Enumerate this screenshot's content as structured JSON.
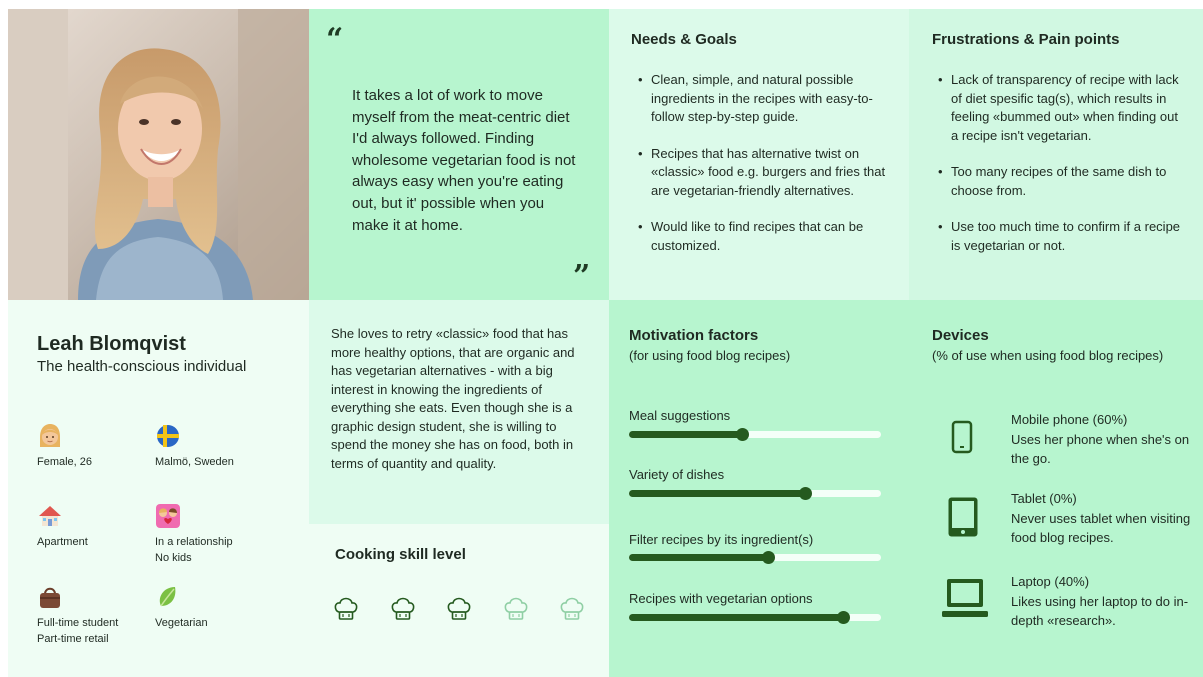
{
  "persona": {
    "name": "Leah Blomqvist",
    "tagline": "The health-conscious individual",
    "attributes": [
      {
        "icon": "woman-face-icon",
        "label": "Female, 26"
      },
      {
        "icon": "swedish-flag-icon",
        "label": "Malmö, Sweden"
      },
      {
        "icon": "house-icon",
        "label": "Apartment"
      },
      {
        "icon": "couple-icon",
        "label": "In a relationship\nNo kids"
      },
      {
        "icon": "handbag-icon",
        "label": "Full-time student\nPart-time retail"
      },
      {
        "icon": "leafy-green-icon",
        "label": "Vegetarian"
      }
    ]
  },
  "quote": {
    "open_mark": "“",
    "close_mark": "”",
    "text": "It takes a lot of work to move myself from the meat-centric diet I'd always followed. Finding wholesome vegetarian food is not always easy when you're eating out, but it' possible when you make it at home."
  },
  "needs_goals": {
    "title": "Needs & Goals",
    "items": [
      "Clean, simple, and natural possible ingredients in the recipes with easy-to-follow step-by-step guide.",
      "Recipes that has alternative twist on «classic» food e.g. burgers and fries that are vegetarian-friendly alternatives.",
      "Would like to find recipes that can be customized."
    ]
  },
  "frustrations": {
    "title": "Frustrations & Pain points",
    "items": [
      "Lack of transparency of recipe with lack of diet spesific tag(s), which results in feeling «bummed out» when finding out a recipe isn't vegetarian.",
      "Too many recipes of the same dish to choose from.",
      "Use too much time to confirm if a recipe is vegetarian or not."
    ]
  },
  "bio": {
    "text": "She loves to retry «classic» food that has more healthy options, that are organic and has vegetarian alternatives - with a big interest in knowing the ingredients of everything she eats. Even though she is a graphic design student, she is willing to spend the money she has on food, both in terms of quantity and quality."
  },
  "cooking_skill": {
    "title": "Cooking skill level",
    "level": 3,
    "max": 5,
    "icon": "chef-hat-icon"
  },
  "motivation": {
    "title": "Motivation factors",
    "subtitle": "(for using food blog recipes)",
    "factors": [
      {
        "label": "Meal suggestions",
        "value": 0.45
      },
      {
        "label": "Variety of dishes",
        "value": 0.7
      },
      {
        "label": "Filter recipes by its ingredient(s)",
        "value": 0.55
      },
      {
        "label": "Recipes with vegetarian options",
        "value": 0.85
      }
    ]
  },
  "devices": {
    "title": "Devices",
    "subtitle": "(% of use when using food blog recipes)",
    "items": [
      {
        "icon": "mobile-phone-icon",
        "name": "Mobile phone (60%)",
        "percent": 60,
        "description": "Uses her phone when she's on the go."
      },
      {
        "icon": "tablet-icon",
        "name": "Tablet (0%)",
        "percent": 0,
        "description": "Never uses tablet when visiting food blog recipes."
      },
      {
        "icon": "laptop-icon",
        "name": "Laptop (40%)",
        "percent": 40,
        "description": "Likes using her laptop to do in-depth «research»."
      }
    ]
  },
  "colors": {
    "accent_dark": "#255a1f",
    "mint": "#b7f5cf",
    "mint_light": "#dcfaea",
    "mint_pale": "#effdf4",
    "hat_inactive": "#8fcfa4"
  }
}
